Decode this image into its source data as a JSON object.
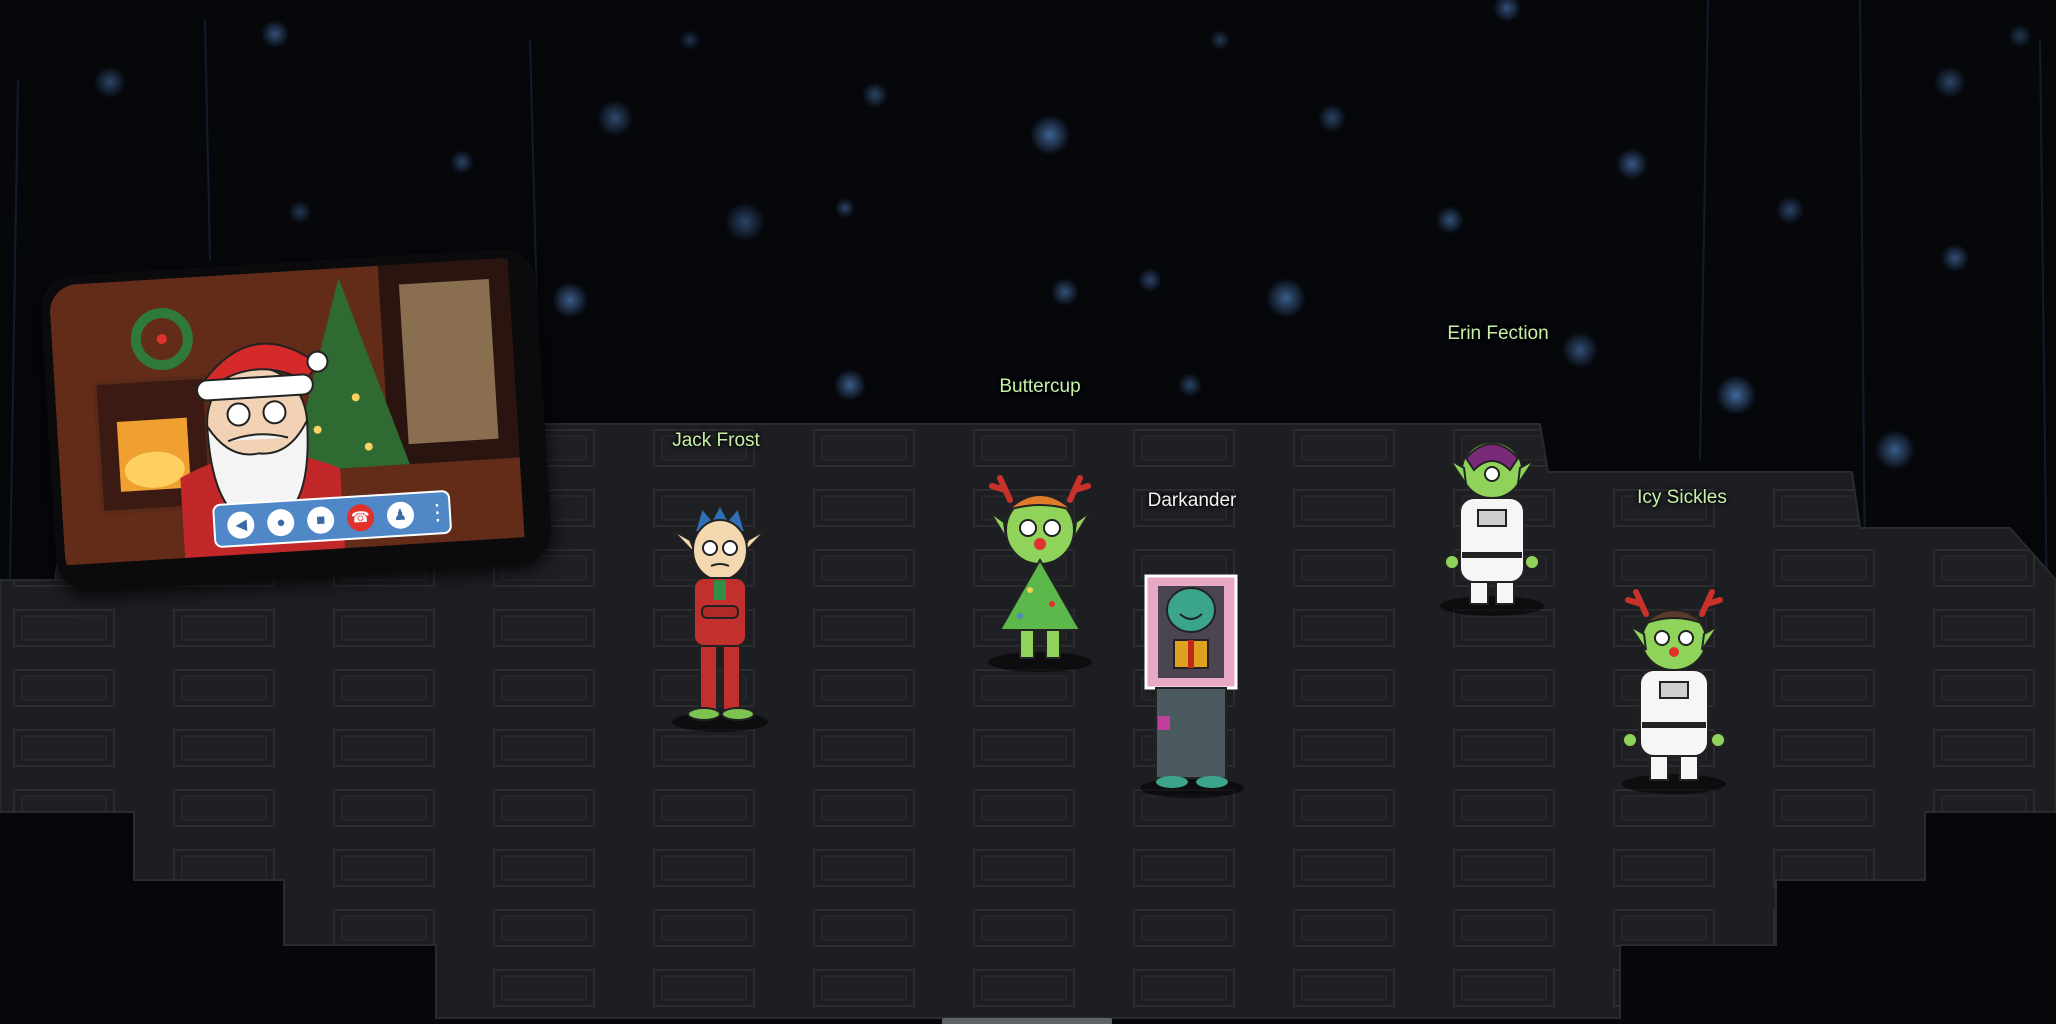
{
  "avatars": [
    {
      "name": "Jack Frost"
    },
    {
      "name": "Buttercup"
    },
    {
      "name": "Darkander"
    },
    {
      "name": "Erin Fection"
    },
    {
      "name": "Icy Sickles"
    }
  ],
  "video_call": {
    "controls": [
      "speaker-icon",
      "microphone-icon",
      "camera-icon",
      "hang-up-icon",
      "participants-icon",
      "more-icon"
    ],
    "hang_up_color": "#e0312b",
    "bar_color": "#4f87c7"
  },
  "colors": {
    "background": "#05070b",
    "floor": "#1c1d21",
    "floor_tile": "#26272b",
    "name_tag": "#c8f0a8",
    "self_name_tag": "#f4f4f4"
  }
}
